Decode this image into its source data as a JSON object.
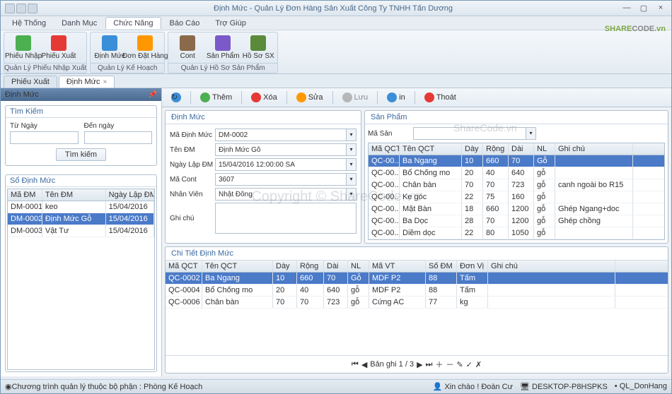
{
  "window": {
    "title": "Định Mức - Quản Lý Đơn Hàng Sản Xuất Công Ty TNHH Tấn Dương"
  },
  "logo": {
    "a": "SHARE",
    "b": "CODE",
    "c": ".vn"
  },
  "menus": [
    "Hệ Thống",
    "Danh Mục",
    "Chức Năng",
    "Báo Cáo",
    "Trợ Giúp"
  ],
  "ribbon": {
    "groups": [
      {
        "label": "Quản Lý Phiếu Nhập Xuất",
        "btns": [
          {
            "t": "Phiếu Nhập"
          },
          {
            "t": "Phiếu Xuất"
          }
        ]
      },
      {
        "label": "Quản Lý Kế Hoạch",
        "btns": [
          {
            "t": "Định Mức"
          },
          {
            "t": "Đơn Đặt Hàng"
          }
        ]
      },
      {
        "label": "Quản Lý Hồ Sơ Sản Phẩm",
        "btns": [
          {
            "t": "Cont"
          },
          {
            "t": "Sản Phẩm"
          },
          {
            "t": "Hồ Sơ SX"
          }
        ]
      }
    ]
  },
  "tabs": [
    {
      "t": "Phiếu Xuất"
    },
    {
      "t": "Định Mức",
      "active": true
    }
  ],
  "leftHeader": "Định Mức",
  "search": {
    "from": "Từ Ngày",
    "to": "Đến ngày",
    "btn": "Tìm kiếm",
    "title": "Tìm Kiếm"
  },
  "dmGrid": {
    "title": "Sổ Định Mức",
    "cols": [
      "Mã ĐM",
      "Tên ĐM",
      "Ngày Lập ĐM"
    ],
    "rows": [
      [
        "DM-0001",
        "keo",
        "15/04/2016"
      ],
      [
        "DM-0002",
        "Định Mức Gỗ",
        "15/04/2016"
      ],
      [
        "DM-0003",
        "Vật Tư",
        "15/04/2016"
      ]
    ],
    "selected": 1
  },
  "toolbar": {
    "add": "Thêm",
    "del": "Xóa",
    "edit": "Sửa",
    "save": "Lưu",
    "print": "in",
    "exit": "Thoát"
  },
  "form": {
    "title": "Định Mức",
    "fields": {
      "maDM": {
        "l": "Mã Định Mức",
        "v": "DM-0002"
      },
      "tenDM": {
        "l": "Tên ĐM",
        "v": "Định Mức Gỗ"
      },
      "ngay": {
        "l": "Ngày Lập ĐM",
        "v": "15/04/2016 12:00:00 SA"
      },
      "maCont": {
        "l": "Mã Cont",
        "v": "3607"
      },
      "nhanVien": {
        "l": "Nhân Viên",
        "v": "Nhật Đông"
      },
      "ghiChu": {
        "l": "Ghi chú",
        "v": ""
      }
    }
  },
  "sp": {
    "title": "Sản Phẩm",
    "searchLabel": "Mã Sản",
    "cols": [
      "Mã QCT",
      "Tên QCT",
      "Dày",
      "Rộng",
      "Dài",
      "NL",
      "Ghi chú"
    ],
    "rows": [
      [
        "QC-00..",
        "Ba Ngang",
        "10",
        "660",
        "70",
        "Gỗ",
        ""
      ],
      [
        "QC-00..",
        "Bổ Chống mo",
        "20",
        "40",
        "640",
        "gỗ",
        ""
      ],
      [
        "QC-00..",
        "Chân bàn",
        "70",
        "70",
        "723",
        "gỗ",
        "canh ngoài bo R15"
      ],
      [
        "QC-00..",
        "Ke góc",
        "22",
        "75",
        "160",
        "gỗ",
        ""
      ],
      [
        "QC-00..",
        "Mặt Bàn",
        "18",
        "660",
        "1200",
        "gỗ",
        "Ghép Ngang+doc"
      ],
      [
        "QC-00..",
        "Ba Dọc",
        "28",
        "70",
        "1200",
        "gỗ",
        "Ghép chồng"
      ],
      [
        "QC-00..",
        "Diềm dọc",
        "22",
        "80",
        "1050",
        "gỗ",
        ""
      ]
    ],
    "selected": 0
  },
  "detail": {
    "title": "Chi Tiết Định Mức",
    "cols": [
      "Mã QCT",
      "Tên QCT",
      "Dày",
      "Rộng",
      "Dài",
      "NL",
      "Mã VT",
      "Số ĐM",
      "Đơn Vị",
      "Ghi chú"
    ],
    "rows": [
      [
        "QC-0002",
        "Ba Ngang",
        "10",
        "660",
        "70",
        "Gỗ",
        "MDF P2",
        "88",
        "Tấm",
        ""
      ],
      [
        "QC-0004",
        "Bổ Chống mo",
        "20",
        "40",
        "640",
        "gỗ",
        "MDF P2",
        "88",
        "Tấm",
        ""
      ],
      [
        "QC-0006",
        "Chân bàn",
        "70",
        "70",
        "723",
        "gỗ",
        "Cứng AC",
        "77",
        "kg",
        ""
      ]
    ],
    "selected": 0,
    "pager": "Bản ghi 1 / 3"
  },
  "status": {
    "left": "Chương trình quản lý thuộc bộ phận : Phòng Kế Hoạch",
    "user": "Xin chào ! Đoàn Cư",
    "pc": "DESKTOP-P8HSPKS",
    "mod": "QL_DonHang"
  },
  "watermark": "Copyright © ShareCode.vn",
  "watermark2": "ShareCode.vn"
}
